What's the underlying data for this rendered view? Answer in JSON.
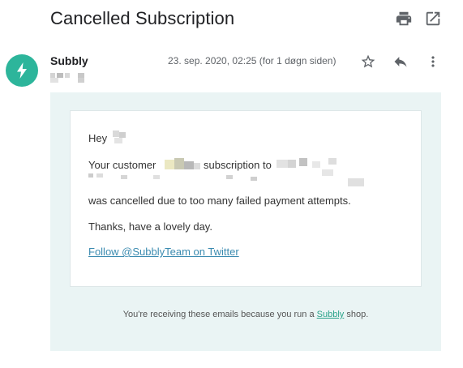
{
  "email": {
    "subject": "Cancelled Subscription",
    "sender": "Subbly",
    "date": "23. sep. 2020, 02:25 (for 1 døgn siden)"
  },
  "toolbar": {
    "print_icon": "print-icon",
    "open_new_window_icon": "open-in-new-icon",
    "star_icon": "star-outline-icon",
    "reply_icon": "reply-icon",
    "more_icon": "more-vert-icon"
  },
  "body": {
    "greeting": "Hey",
    "line1_a": "Your customer",
    "line1_b": "subscription to",
    "line2": "was cancelled due to too many failed payment attempts.",
    "thanks": "Thanks, have a lovely day.",
    "twitter_link": "Follow @SubblyTeam on Twitter"
  },
  "footer": {
    "text_before": "You're receiving these emails because you run a",
    "link": "Subbly",
    "text_after": "shop."
  },
  "colors": {
    "brand": "#2db59b",
    "body_bg": "#eaf4f4",
    "link": "#3b8bb0"
  }
}
